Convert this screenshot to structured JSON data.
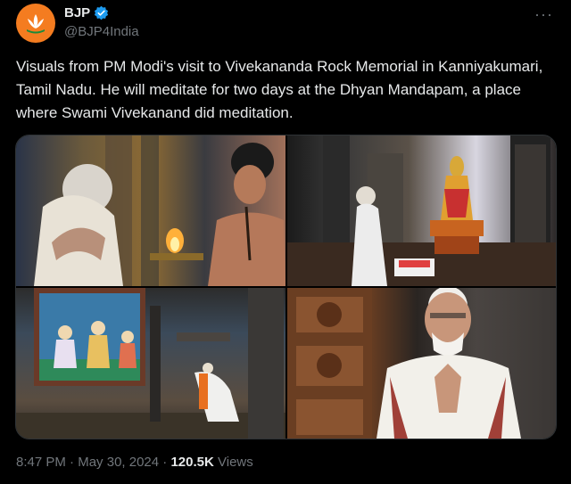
{
  "account": {
    "display_name": "BJP",
    "handle": "@BJP4India"
  },
  "tweet": {
    "text": "Visuals from PM Modi's visit to Vivekananda Rock Memorial in Kanniyakumari, Tamil Nadu. He will meditate for two days at the Dhyan Mandapam, a place where Swami Vivekanand did meditation."
  },
  "meta": {
    "time": "8:47 PM",
    "separator": " · ",
    "date": "May 30, 2024",
    "views_count": "120.5K",
    "views_label": "Views"
  },
  "colors": {
    "background": "#000000",
    "text": "#e7e9ea",
    "secondary": "#71767b",
    "verified": "#1d9bf0",
    "avatar": "#f47c20"
  },
  "icons": {
    "avatar": "bjp-lotus-logo",
    "verified": "verified-badge-icon",
    "more": "more-options-icon"
  }
}
